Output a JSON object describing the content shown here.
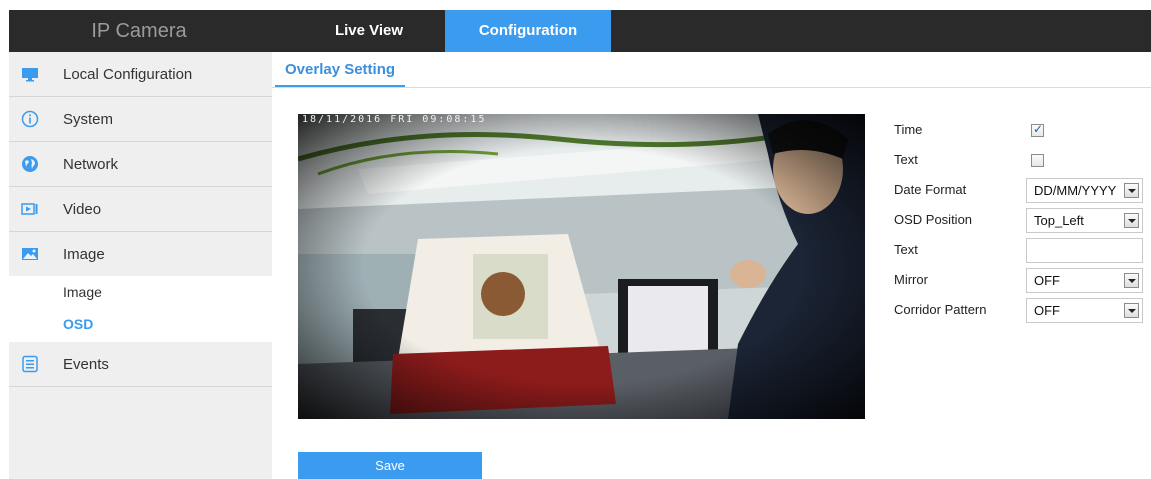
{
  "header": {
    "brand": "IP Camera",
    "tabs": [
      {
        "label": "Live View",
        "active": false
      },
      {
        "label": "Configuration",
        "active": true
      }
    ],
    "accent_color": "#3b9bee"
  },
  "sidebar": {
    "items": [
      {
        "label": "Local Configuration",
        "icon": "monitor-icon"
      },
      {
        "label": "System",
        "icon": "info-icon"
      },
      {
        "label": "Network",
        "icon": "globe-icon"
      },
      {
        "label": "Video",
        "icon": "video-icon"
      },
      {
        "label": "Image",
        "icon": "image-icon"
      },
      {
        "label": "Events",
        "icon": "events-icon"
      }
    ],
    "sub_items": [
      {
        "label": "Image",
        "active": false
      },
      {
        "label": "OSD",
        "active": true
      }
    ]
  },
  "main": {
    "tab": "Overlay Setting",
    "preview": {
      "osd_timestamp": "18/11/2016 FRI 09:08:15"
    },
    "form": {
      "time_label": "Time",
      "time_checked": true,
      "text_toggle_label": "Text",
      "text_checked": false,
      "date_format_label": "Date Format",
      "date_format_value": "DD/MM/YYYY",
      "osd_position_label": "OSD Position",
      "osd_position_value": "Top_Left",
      "text_label": "Text",
      "text_value": "",
      "mirror_label": "Mirror",
      "mirror_value": "OFF",
      "corridor_label": "Corridor Pattern",
      "corridor_value": "OFF"
    },
    "save_label": "Save"
  }
}
